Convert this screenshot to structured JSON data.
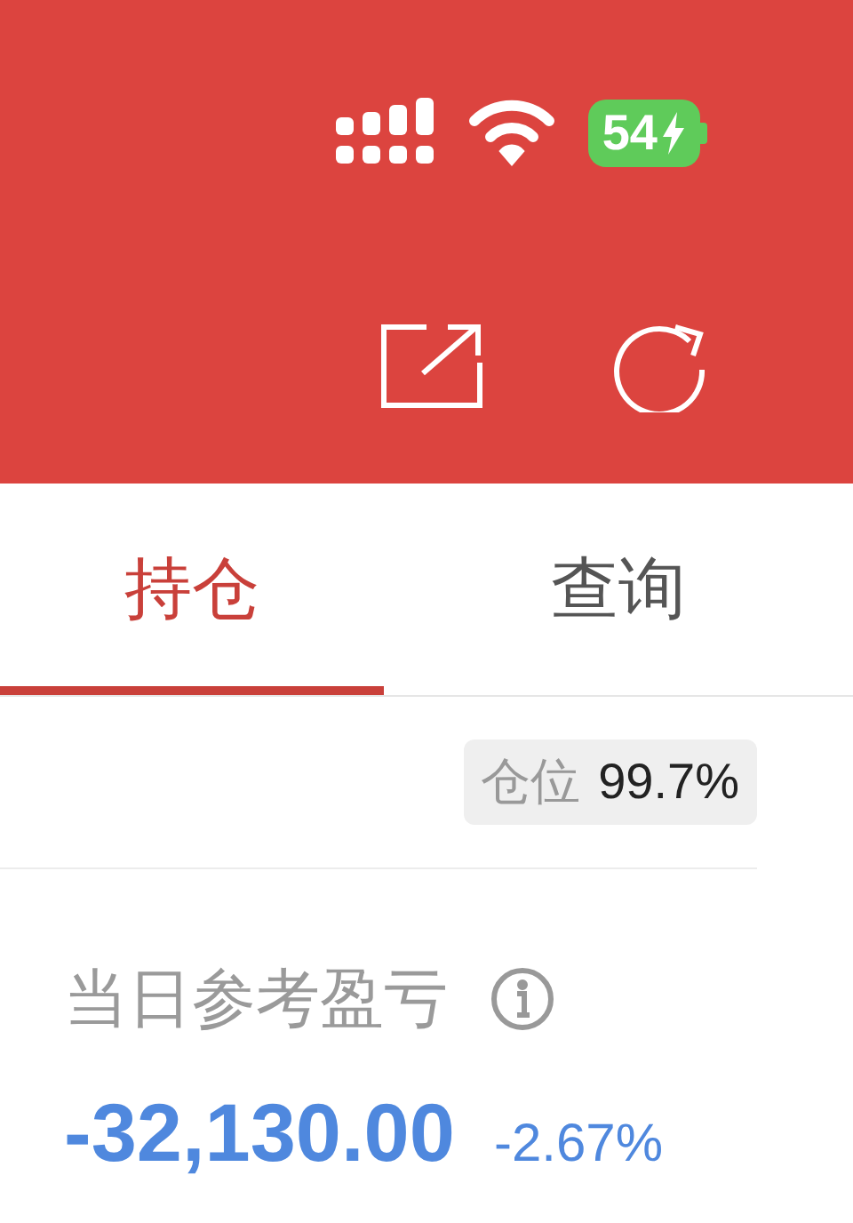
{
  "status_bar": {
    "battery": "54",
    "charging": true
  },
  "tabs": [
    {
      "label": "持仓",
      "selected": true
    },
    {
      "label": "查询",
      "selected": false
    }
  ],
  "position_badge": {
    "label": "仓位",
    "value": "99.7%"
  },
  "daily_pnl": {
    "label": "当日参考盈亏",
    "amount": "-32,130.00",
    "percent": "-2.67%"
  }
}
